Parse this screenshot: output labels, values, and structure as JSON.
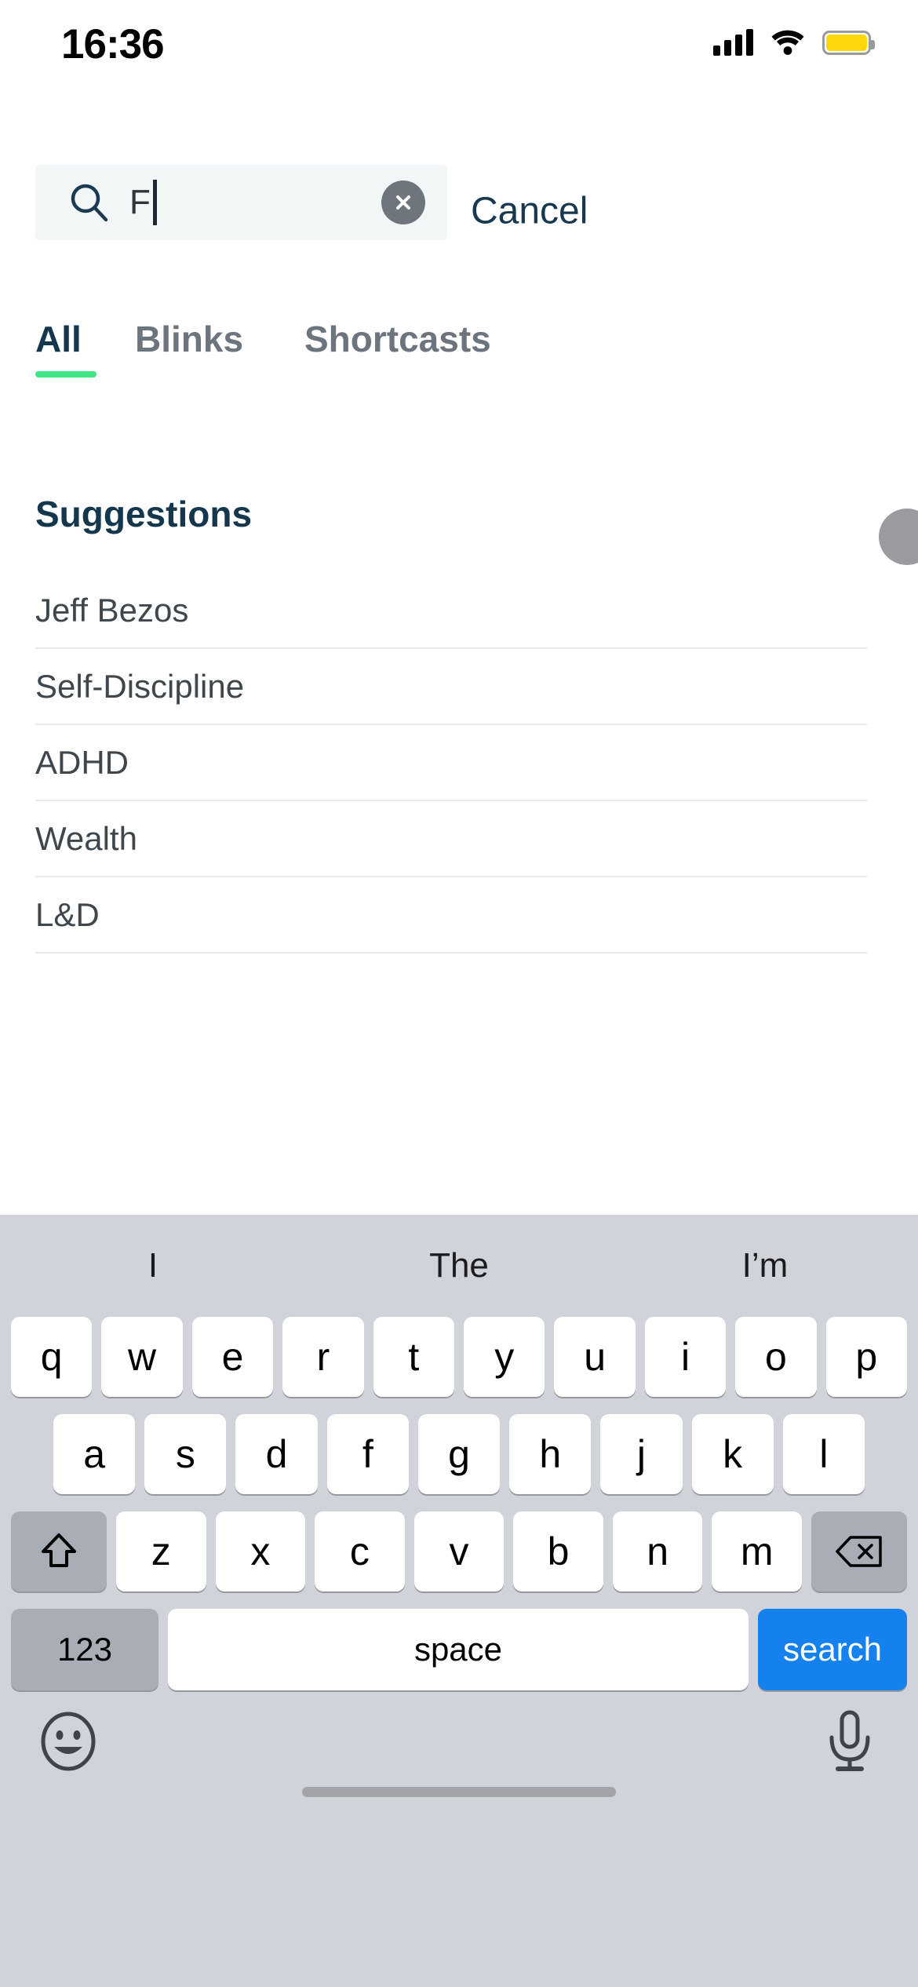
{
  "status_bar": {
    "time": "16:36",
    "cellular_icon": "cellular-bars-icon",
    "wifi_icon": "wifi-icon",
    "battery_icon": "battery-icon",
    "battery_color": "#ffd60a"
  },
  "search": {
    "value": "F",
    "placeholder": "Search",
    "search_icon": "search-icon",
    "clear_icon": "clear-circle-icon",
    "cancel_label": "Cancel"
  },
  "tabs": {
    "items": [
      {
        "label": "All",
        "active": true
      },
      {
        "label": "Blinks",
        "active": false
      },
      {
        "label": "Shortcasts",
        "active": false
      }
    ],
    "active_underline_color": "#3ee685"
  },
  "suggestions": {
    "heading": "Suggestions",
    "items": [
      {
        "label": "Jeff Bezos"
      },
      {
        "label": "Self-Discipline"
      },
      {
        "label": "ADHD"
      },
      {
        "label": "Wealth"
      },
      {
        "label": "L&D"
      }
    ]
  },
  "keyboard": {
    "predictions": [
      "I",
      "The",
      "I’m"
    ],
    "row1": [
      "q",
      "w",
      "e",
      "r",
      "t",
      "y",
      "u",
      "i",
      "o",
      "p"
    ],
    "row2": [
      "a",
      "s",
      "d",
      "f",
      "g",
      "h",
      "j",
      "k",
      "l"
    ],
    "row3": [
      "z",
      "x",
      "c",
      "v",
      "b",
      "n",
      "m"
    ],
    "shift_icon": "shift-arrow-icon",
    "delete_icon": "backspace-delete-icon",
    "numbers_label": "123",
    "space_label": "space",
    "action_label": "search",
    "action_color": "#1581ef",
    "emoji_icon": "emoji-smiley-icon",
    "mic_icon": "microphone-icon"
  }
}
